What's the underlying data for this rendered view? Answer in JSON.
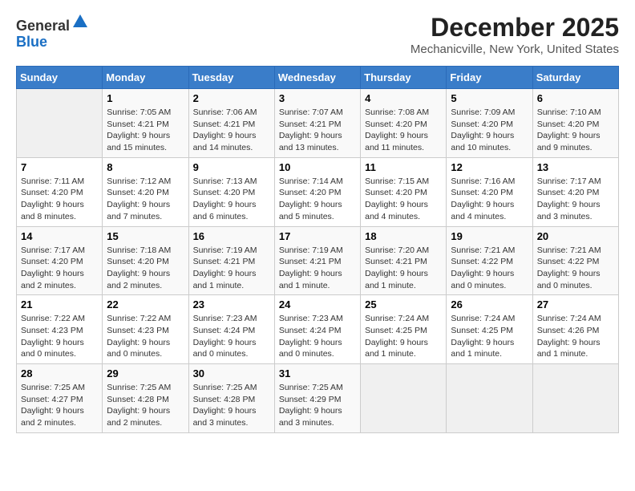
{
  "header": {
    "logo_general": "General",
    "logo_blue": "Blue",
    "title": "December 2025",
    "subtitle": "Mechanicville, New York, United States"
  },
  "calendar": {
    "days_of_week": [
      "Sunday",
      "Monday",
      "Tuesday",
      "Wednesday",
      "Thursday",
      "Friday",
      "Saturday"
    ],
    "weeks": [
      [
        {
          "day": "",
          "empty": true
        },
        {
          "day": "1",
          "sunrise": "Sunrise: 7:05 AM",
          "sunset": "Sunset: 4:21 PM",
          "daylight": "Daylight: 9 hours and 15 minutes."
        },
        {
          "day": "2",
          "sunrise": "Sunrise: 7:06 AM",
          "sunset": "Sunset: 4:21 PM",
          "daylight": "Daylight: 9 hours and 14 minutes."
        },
        {
          "day": "3",
          "sunrise": "Sunrise: 7:07 AM",
          "sunset": "Sunset: 4:21 PM",
          "daylight": "Daylight: 9 hours and 13 minutes."
        },
        {
          "day": "4",
          "sunrise": "Sunrise: 7:08 AM",
          "sunset": "Sunset: 4:20 PM",
          "daylight": "Daylight: 9 hours and 11 minutes."
        },
        {
          "day": "5",
          "sunrise": "Sunrise: 7:09 AM",
          "sunset": "Sunset: 4:20 PM",
          "daylight": "Daylight: 9 hours and 10 minutes."
        },
        {
          "day": "6",
          "sunrise": "Sunrise: 7:10 AM",
          "sunset": "Sunset: 4:20 PM",
          "daylight": "Daylight: 9 hours and 9 minutes."
        }
      ],
      [
        {
          "day": "7",
          "sunrise": "Sunrise: 7:11 AM",
          "sunset": "Sunset: 4:20 PM",
          "daylight": "Daylight: 9 hours and 8 minutes."
        },
        {
          "day": "8",
          "sunrise": "Sunrise: 7:12 AM",
          "sunset": "Sunset: 4:20 PM",
          "daylight": "Daylight: 9 hours and 7 minutes."
        },
        {
          "day": "9",
          "sunrise": "Sunrise: 7:13 AM",
          "sunset": "Sunset: 4:20 PM",
          "daylight": "Daylight: 9 hours and 6 minutes."
        },
        {
          "day": "10",
          "sunrise": "Sunrise: 7:14 AM",
          "sunset": "Sunset: 4:20 PM",
          "daylight": "Daylight: 9 hours and 5 minutes."
        },
        {
          "day": "11",
          "sunrise": "Sunrise: 7:15 AM",
          "sunset": "Sunset: 4:20 PM",
          "daylight": "Daylight: 9 hours and 4 minutes."
        },
        {
          "day": "12",
          "sunrise": "Sunrise: 7:16 AM",
          "sunset": "Sunset: 4:20 PM",
          "daylight": "Daylight: 9 hours and 4 minutes."
        },
        {
          "day": "13",
          "sunrise": "Sunrise: 7:17 AM",
          "sunset": "Sunset: 4:20 PM",
          "daylight": "Daylight: 9 hours and 3 minutes."
        }
      ],
      [
        {
          "day": "14",
          "sunrise": "Sunrise: 7:17 AM",
          "sunset": "Sunset: 4:20 PM",
          "daylight": "Daylight: 9 hours and 2 minutes."
        },
        {
          "day": "15",
          "sunrise": "Sunrise: 7:18 AM",
          "sunset": "Sunset: 4:20 PM",
          "daylight": "Daylight: 9 hours and 2 minutes."
        },
        {
          "day": "16",
          "sunrise": "Sunrise: 7:19 AM",
          "sunset": "Sunset: 4:21 PM",
          "daylight": "Daylight: 9 hours and 1 minute."
        },
        {
          "day": "17",
          "sunrise": "Sunrise: 7:19 AM",
          "sunset": "Sunset: 4:21 PM",
          "daylight": "Daylight: 9 hours and 1 minute."
        },
        {
          "day": "18",
          "sunrise": "Sunrise: 7:20 AM",
          "sunset": "Sunset: 4:21 PM",
          "daylight": "Daylight: 9 hours and 1 minute."
        },
        {
          "day": "19",
          "sunrise": "Sunrise: 7:21 AM",
          "sunset": "Sunset: 4:22 PM",
          "daylight": "Daylight: 9 hours and 0 minutes."
        },
        {
          "day": "20",
          "sunrise": "Sunrise: 7:21 AM",
          "sunset": "Sunset: 4:22 PM",
          "daylight": "Daylight: 9 hours and 0 minutes."
        }
      ],
      [
        {
          "day": "21",
          "sunrise": "Sunrise: 7:22 AM",
          "sunset": "Sunset: 4:23 PM",
          "daylight": "Daylight: 9 hours and 0 minutes."
        },
        {
          "day": "22",
          "sunrise": "Sunrise: 7:22 AM",
          "sunset": "Sunset: 4:23 PM",
          "daylight": "Daylight: 9 hours and 0 minutes."
        },
        {
          "day": "23",
          "sunrise": "Sunrise: 7:23 AM",
          "sunset": "Sunset: 4:24 PM",
          "daylight": "Daylight: 9 hours and 0 minutes."
        },
        {
          "day": "24",
          "sunrise": "Sunrise: 7:23 AM",
          "sunset": "Sunset: 4:24 PM",
          "daylight": "Daylight: 9 hours and 0 minutes."
        },
        {
          "day": "25",
          "sunrise": "Sunrise: 7:24 AM",
          "sunset": "Sunset: 4:25 PM",
          "daylight": "Daylight: 9 hours and 1 minute."
        },
        {
          "day": "26",
          "sunrise": "Sunrise: 7:24 AM",
          "sunset": "Sunset: 4:25 PM",
          "daylight": "Daylight: 9 hours and 1 minute."
        },
        {
          "day": "27",
          "sunrise": "Sunrise: 7:24 AM",
          "sunset": "Sunset: 4:26 PM",
          "daylight": "Daylight: 9 hours and 1 minute."
        }
      ],
      [
        {
          "day": "28",
          "sunrise": "Sunrise: 7:25 AM",
          "sunset": "Sunset: 4:27 PM",
          "daylight": "Daylight: 9 hours and 2 minutes."
        },
        {
          "day": "29",
          "sunrise": "Sunrise: 7:25 AM",
          "sunset": "Sunset: 4:28 PM",
          "daylight": "Daylight: 9 hours and 2 minutes."
        },
        {
          "day": "30",
          "sunrise": "Sunrise: 7:25 AM",
          "sunset": "Sunset: 4:28 PM",
          "daylight": "Daylight: 9 hours and 3 minutes."
        },
        {
          "day": "31",
          "sunrise": "Sunrise: 7:25 AM",
          "sunset": "Sunset: 4:29 PM",
          "daylight": "Daylight: 9 hours and 3 minutes."
        },
        {
          "day": "",
          "empty": true
        },
        {
          "day": "",
          "empty": true
        },
        {
          "day": "",
          "empty": true
        }
      ]
    ]
  }
}
